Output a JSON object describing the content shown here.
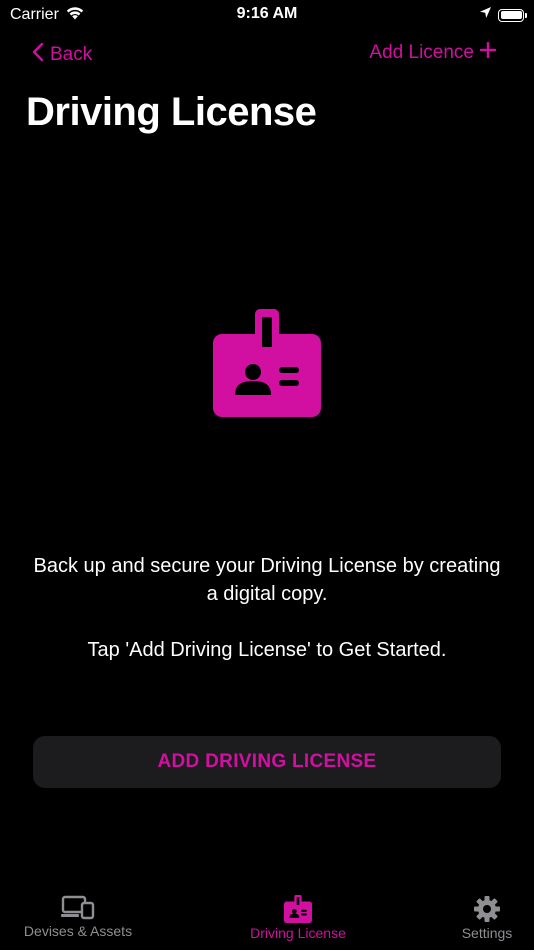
{
  "status_bar": {
    "carrier": "Carrier",
    "time": "9:16 AM",
    "icons": [
      "wifi-icon",
      "location-icon",
      "battery-icon"
    ]
  },
  "nav": {
    "back_label": "Back",
    "add_label": "Add Licence",
    "icons": [
      "chevron-left-icon",
      "plus-icon"
    ]
  },
  "page": {
    "title": "Driving License",
    "icon": "id-badge-icon",
    "message_line1": "Back up and secure your Driving License by creating a digital copy.",
    "message_line2": "Tap 'Add Driving License' to Get Started.",
    "button_label": "ADD DRIVING LICENSE"
  },
  "tabs": [
    {
      "label": "Devises & Assets",
      "icon": "devices-icon",
      "active": false
    },
    {
      "label": "Driving License",
      "icon": "id-badge-icon",
      "active": true
    },
    {
      "label": "Settings",
      "icon": "gear-icon",
      "active": false
    }
  ],
  "colors": {
    "accent": "#d10fa0",
    "background": "#000000",
    "button_bg": "#1c1c1e",
    "inactive_tab": "#8e8e93"
  }
}
